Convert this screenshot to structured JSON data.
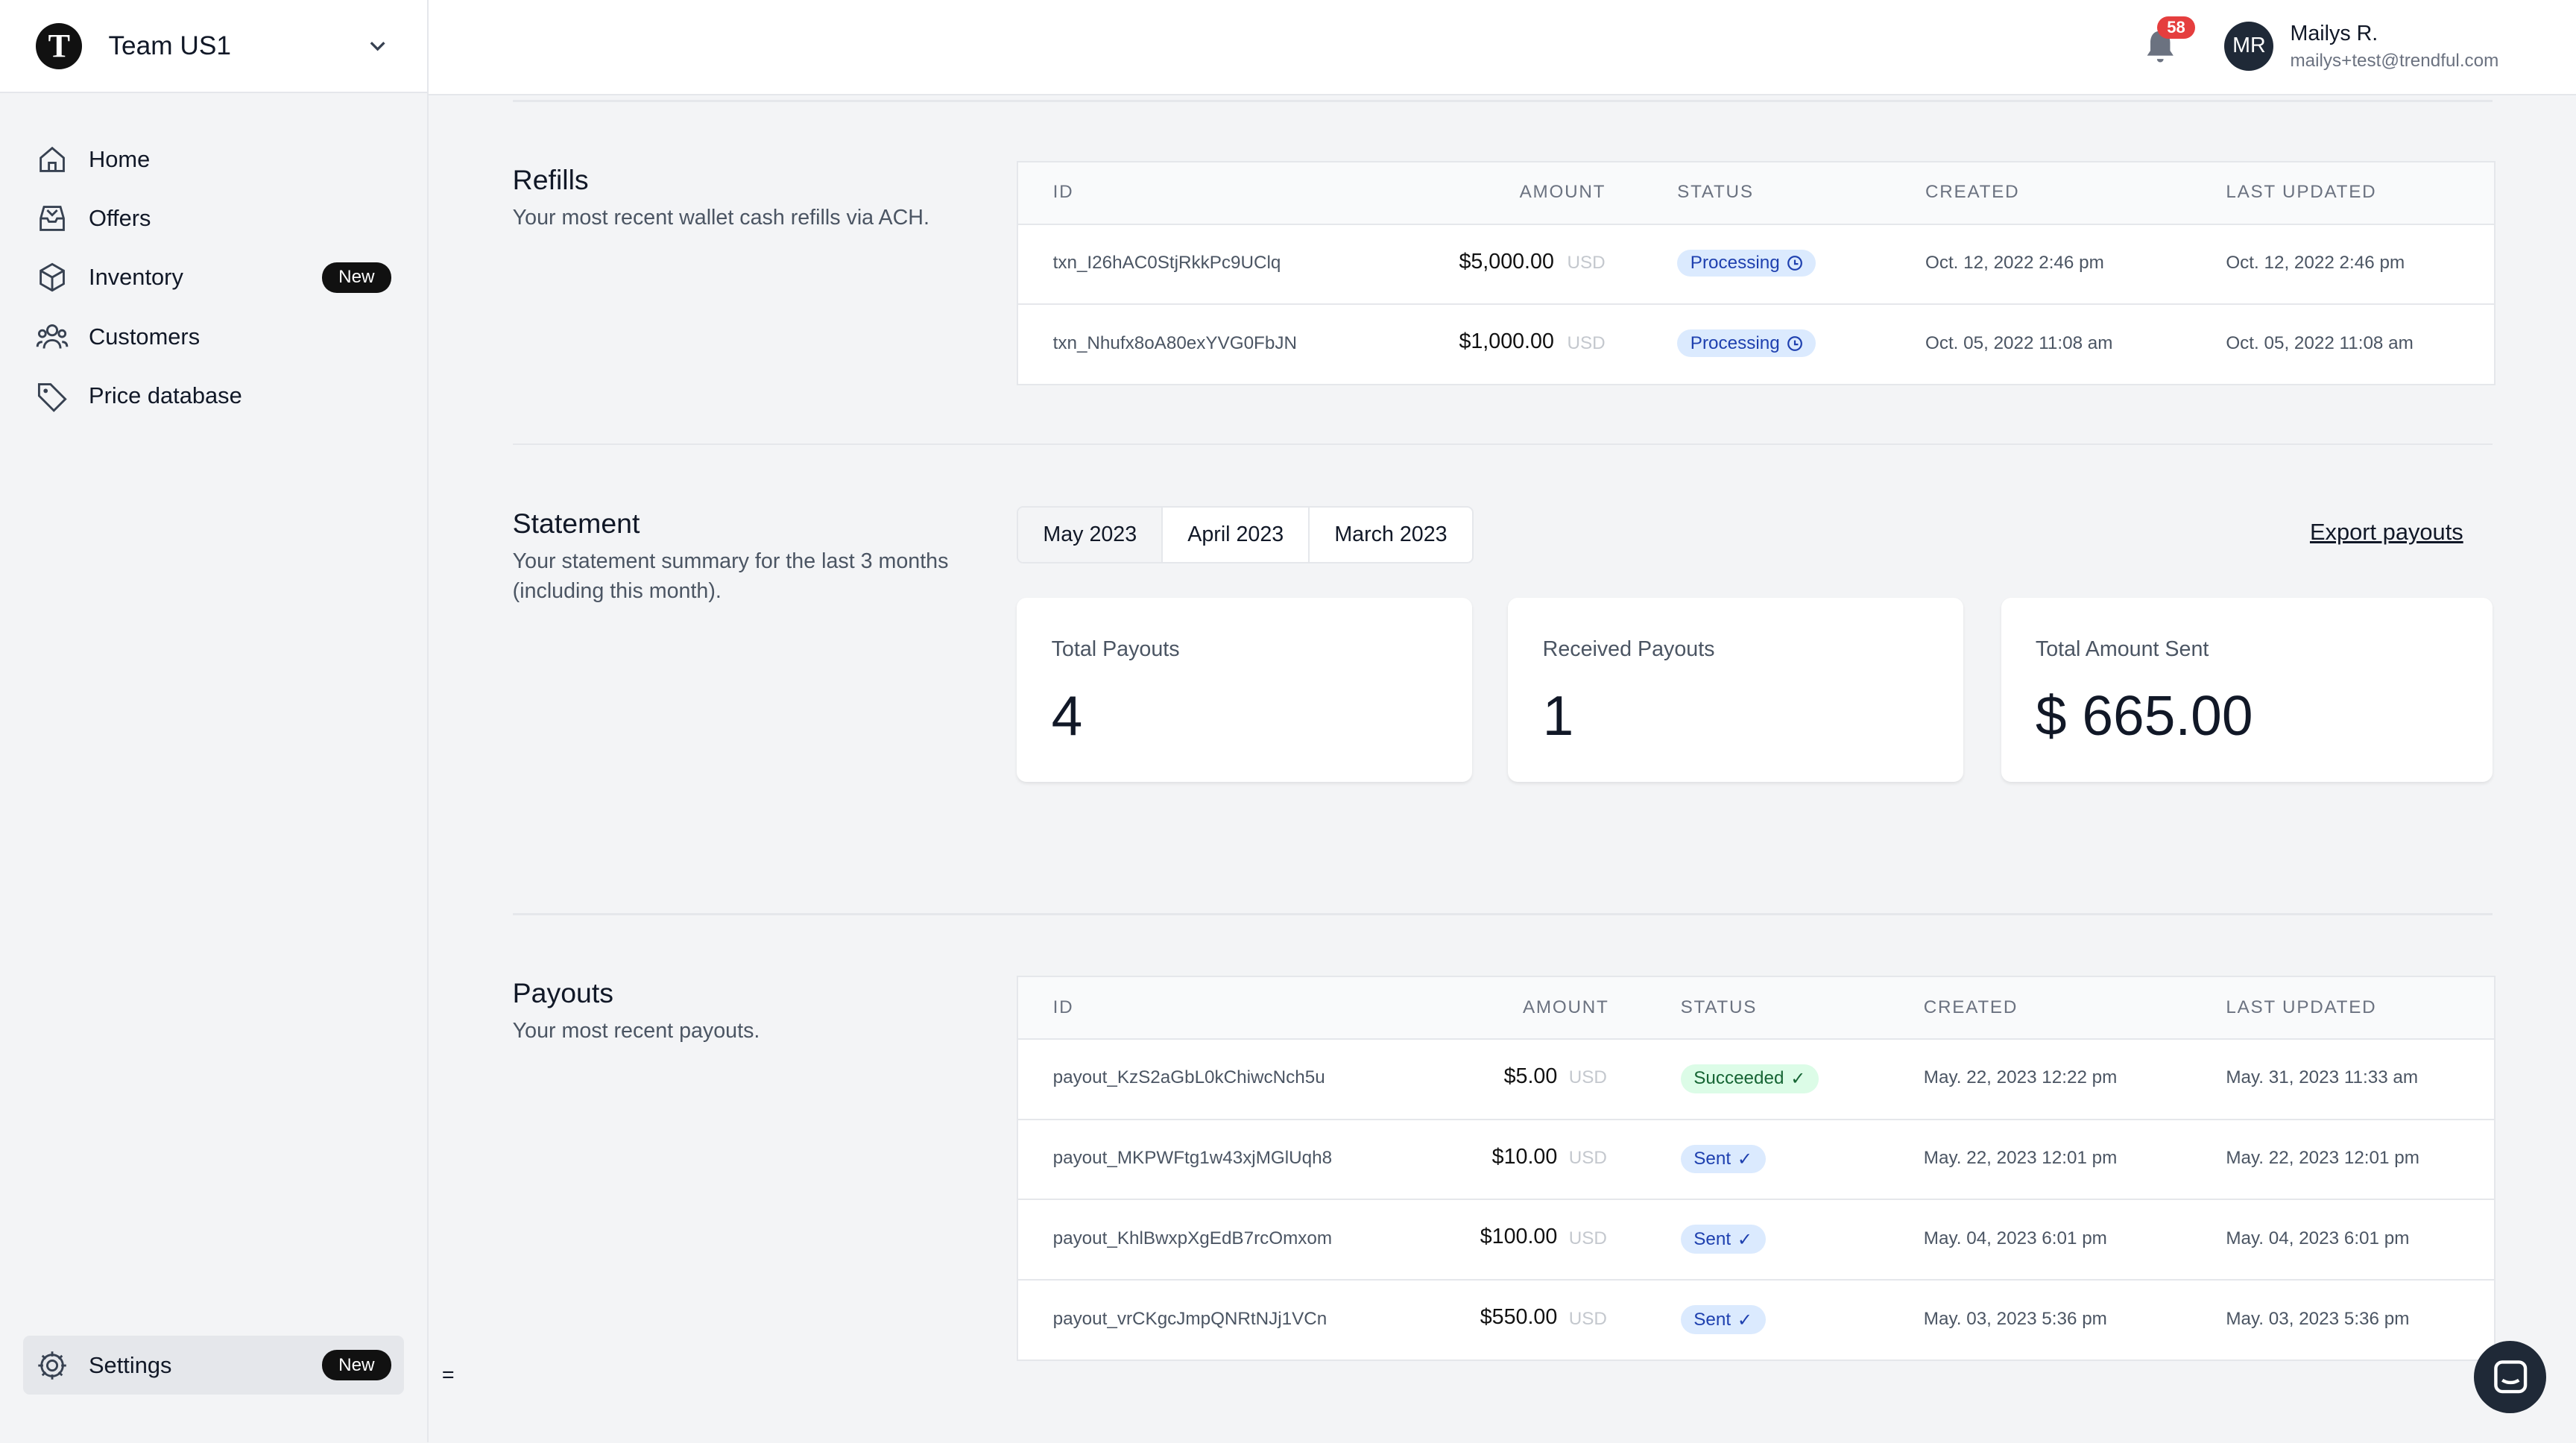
{
  "team": {
    "name": "Team US1",
    "logo_letter": "T"
  },
  "nav": {
    "items": [
      {
        "label": "Home",
        "icon": "home-icon"
      },
      {
        "label": "Offers",
        "icon": "inbox-icon"
      },
      {
        "label": "Inventory",
        "icon": "box-icon",
        "badge": "New"
      },
      {
        "label": "Customers",
        "icon": "users-icon"
      },
      {
        "label": "Price database",
        "icon": "tag-icon"
      }
    ],
    "settings": {
      "label": "Settings",
      "badge": "New"
    }
  },
  "footer_symbol": "=",
  "header": {
    "notifications_count": "58",
    "user": {
      "initials": "MR",
      "name": "Mailys R.",
      "email": "mailys+test@trendful.com"
    }
  },
  "refills": {
    "title": "Refills",
    "description": "Your most recent wallet cash refills via ACH.",
    "columns": [
      "ID",
      "AMOUNT",
      "STATUS",
      "CREATED",
      "LAST UPDATED"
    ],
    "rows": [
      {
        "id": "txn_I26hAC0StjRkkPc9UClq",
        "amount": "$5,000.00",
        "currency": "USD",
        "status": "Processing",
        "created": "Oct. 12, 2022 2:46 pm",
        "updated": "Oct. 12, 2022 2:46 pm"
      },
      {
        "id": "txn_Nhufx8oA80exYVG0FbJN",
        "amount": "$1,000.00",
        "currency": "USD",
        "status": "Processing",
        "created": "Oct. 05, 2022 11:08 am",
        "updated": "Oct. 05, 2022 11:08 am"
      }
    ]
  },
  "statement": {
    "title": "Statement",
    "description": "Your statement summary for the last 3 months (including this month).",
    "tabs": [
      "May 2023",
      "April 2023",
      "March 2023"
    ],
    "active_tab": "May 2023",
    "export_label": "Export payouts",
    "cards": [
      {
        "label": "Total Payouts",
        "value": "4"
      },
      {
        "label": "Received Payouts",
        "value": "1"
      },
      {
        "label": "Total Amount Sent",
        "value": "$ 665.00"
      }
    ]
  },
  "payouts": {
    "title": "Payouts",
    "description": "Your most recent payouts.",
    "columns": [
      "ID",
      "AMOUNT",
      "STATUS",
      "CREATED",
      "LAST UPDATED"
    ],
    "rows": [
      {
        "id": "payout_KzS2aGbL0kChiwcNch5u",
        "amount": "$5.00",
        "currency": "USD",
        "status": "Succeeded",
        "created": "May. 22, 2023 12:22 pm",
        "updated": "May. 31, 2023 11:33 am"
      },
      {
        "id": "payout_MKPWFtg1w43xjMGlUqh8",
        "amount": "$10.00",
        "currency": "USD",
        "status": "Sent",
        "created": "May. 22, 2023 12:01 pm",
        "updated": "May. 22, 2023 12:01 pm"
      },
      {
        "id": "payout_KhlBwxpXgEdB7rcOmxom",
        "amount": "$100.00",
        "currency": "USD",
        "status": "Sent",
        "created": "May. 04, 2023 6:01 pm",
        "updated": "May. 04, 2023 6:01 pm"
      },
      {
        "id": "payout_vrCKgcJmpQNRtNJj1VCn",
        "amount": "$550.00",
        "currency": "USD",
        "status": "Sent",
        "created": "May. 03, 2023 5:36 pm",
        "updated": "May. 03, 2023 5:36 pm"
      }
    ]
  },
  "colors": {
    "accent": "#111111",
    "processing": "#1e40af",
    "succeeded": "#166534",
    "notification": "#e53e3e"
  }
}
